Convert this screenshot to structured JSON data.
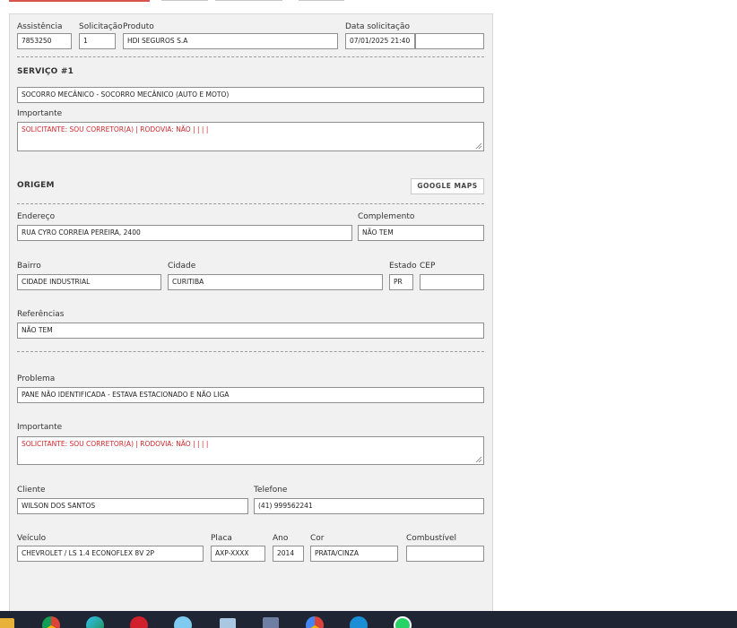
{
  "header": {
    "assistencia_label": "Assistência",
    "assistencia_value": "7853250",
    "solicitacao_label": "Solicitação",
    "solicitacao_value": "1",
    "produto_label": "Produto",
    "produto_value": "HDI SEGUROS S.A",
    "data_label": "Data solicitação",
    "data_value": "07/01/2025 21:40",
    "extra_value": ""
  },
  "servico": {
    "title": "SERVIÇO #1",
    "tipo_value": "SOCORRO MECÂNICO - SOCORRO MECÂNICO (AUTO E MOTO)",
    "importante_label": "Importante",
    "importante_value": "SOLICITANTE: SOU CORRETOR(A) | RODOVIA: NÃO |  |   |   |"
  },
  "origem": {
    "title": "ORIGEM",
    "maps_button": "GOOGLE MAPS",
    "endereco_label": "Endereço",
    "endereco_value": "RUA CYRO CORREIA PEREIRA, 2400",
    "complemento_label": "Complemento",
    "complemento_value": "NÃO TEM",
    "bairro_label": "Bairro",
    "bairro_value": "CIDADE INDUSTRIAL",
    "cidade_label": "Cidade",
    "cidade_value": "CURITIBA",
    "estado_label": "Estado",
    "estado_value": "PR",
    "cep_label": "CEP",
    "cep_value": "",
    "referencias_label": "Referências",
    "referencias_value": "NÃO TEM"
  },
  "problema": {
    "problema_label": "Problema",
    "problema_value": "PANE NÃO IDENTIFICADA - ESTAVA ESTACIONADO E NÃO LIGA",
    "importante_label": "Importante",
    "importante_value": "SOLICITANTE: SOU CORRETOR(A) | RODOVIA: NÃO |  |   |   |"
  },
  "cliente": {
    "cliente_label": "Cliente",
    "cliente_value": "WILSON DOS SANTOS",
    "telefone_label": "Telefone",
    "telefone_value": "(41) 999562241"
  },
  "veiculo": {
    "veiculo_label": "Veículo",
    "veiculo_value": "CHEVROLET / LS 1.4 ECONOFLEX 8V 2P",
    "placa_label": "Placa",
    "placa_value": "AXP-XXXX",
    "ano_label": "Ano",
    "ano_value": "2014",
    "cor_label": "Cor",
    "cor_value": "PRATA/CINZA",
    "combustivel_label": "Combustível",
    "combustivel_value": ""
  },
  "taskbar": {
    "icons": [
      "file-explorer-icon",
      "chrome-icon",
      "edge-icon",
      "opera-icon",
      "photos-icon",
      "notepad-icon",
      "calculator-icon",
      "chrome-profile-icon",
      "edge-profile-icon",
      "whatsapp-icon"
    ]
  },
  "colors": {
    "accent_red": "#d0262b",
    "panel_bg": "#f1f1f1",
    "taskbar_bg": "#1f2533"
  }
}
